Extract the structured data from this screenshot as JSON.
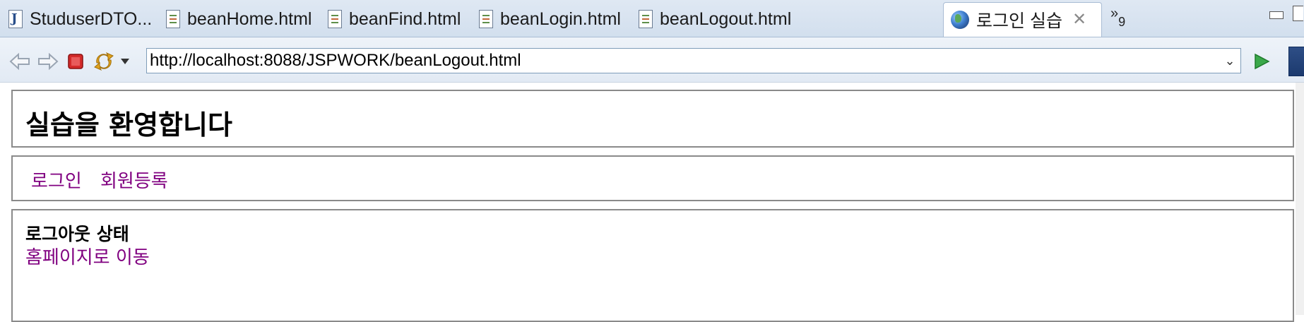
{
  "tabs": [
    {
      "label": "StuduserDTO...",
      "icon": "java-file-icon"
    },
    {
      "label": "beanHome.html",
      "icon": "html-file-icon"
    },
    {
      "label": "beanFind.html",
      "icon": "html-file-icon"
    },
    {
      "label": "beanLogin.html",
      "icon": "html-file-icon"
    },
    {
      "label": "beanLogout.html",
      "icon": "html-file-icon"
    },
    {
      "label": "로그인 실습",
      "icon": "globe-icon",
      "active": true
    }
  ],
  "overflow": {
    "chevron": "»",
    "count": "9"
  },
  "toolbar": {
    "url": "http://localhost:8088/JSPWORK/beanLogout.html",
    "stop_color": "#d42a2a",
    "go_color": "#3aa84a"
  },
  "page": {
    "title": "실습을 환영합니다",
    "nav": [
      "로그인",
      "회원등록"
    ],
    "status": "로그아웃 상태",
    "home_link": "홈페이지로 이동",
    "link_color": "#800080"
  }
}
